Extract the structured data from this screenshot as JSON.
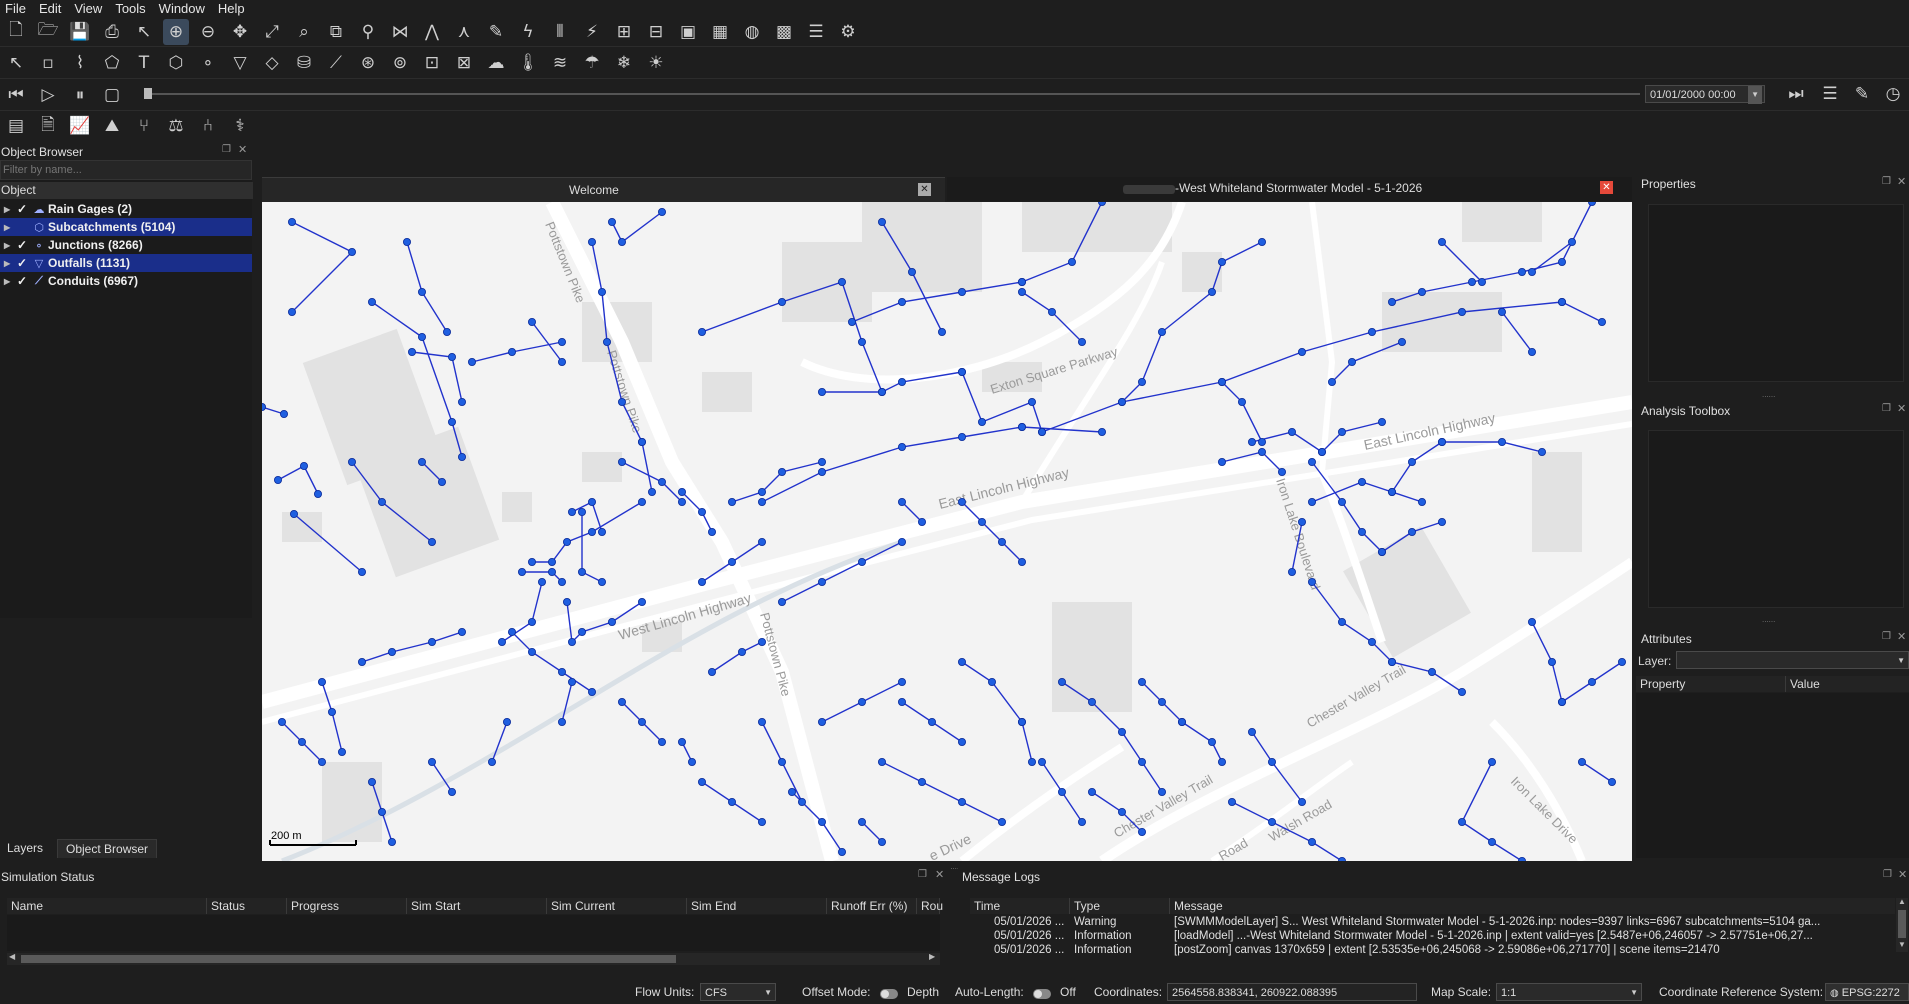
{
  "menu": [
    "File",
    "Edit",
    "View",
    "Tools",
    "Window",
    "Help"
  ],
  "toolbar1_icons": [
    "new-file-icon",
    "open-folder-icon",
    "save-icon",
    "print-icon",
    "select-icon",
    "zoom-in-icon",
    "zoom-out-icon",
    "pan-icon",
    "full-extent-icon",
    "zoom-rect-icon",
    "copy-icon",
    "find-icon",
    "network-icon",
    "vertex-icon",
    "profile-icon",
    "measure-icon",
    "flash-icon",
    "columns-icon",
    "lightning-icon",
    "map-add-icon",
    "map-edit-icon",
    "image-icon",
    "checker-icon",
    "globe-icon",
    "grid-icon",
    "sliders-icon",
    "settings-icon"
  ],
  "toolbar1_glyphs": [
    "🗋",
    "🗁",
    "💾",
    "⎙",
    "↖",
    "⊕",
    "⊖",
    "✥",
    "⤢",
    "⌕",
    "⧉",
    "⚲",
    "⋈",
    "⋀",
    "⋏",
    "✎",
    "ϟ",
    "⫴",
    "⚡",
    "⊞",
    "⊟",
    "▣",
    "▦",
    "◍",
    "▩",
    "☰",
    "⚙"
  ],
  "toolbar2_icons": [
    "select-arrow-icon",
    "node-icon",
    "polyline-icon",
    "polygon-icon",
    "text-icon",
    "polygon-draw-icon",
    "circle-icon",
    "outfall-icon",
    "diamond-icon",
    "storage-icon",
    "conduit-icon",
    "pump-icon",
    "orifice-icon",
    "weir-icon",
    "outlet-icon",
    "cloud-icon",
    "thermometer-icon",
    "wind-icon",
    "rain-cloud-icon",
    "snow-icon",
    "sun-icon"
  ],
  "toolbar2_glyphs": [
    "↖",
    "▫",
    "⌇",
    "⬠",
    "T",
    "⬡",
    "∘",
    "▽",
    "◇",
    "⛁",
    "⟋",
    "⊛",
    "⊚",
    "⊡",
    "⊠",
    "☁",
    "🌡",
    "≋",
    "☂",
    "❄",
    "☀"
  ],
  "toolbar3": {
    "datetime": "01/01/2000 00:00"
  },
  "toolbar4_icons": [
    "report-icon",
    "document-icon",
    "line-graph-icon",
    "profile-plot-icon",
    "branch-icon",
    "calibrate-icon",
    "tree-icon",
    "analysis-icon"
  ],
  "toolbar4_glyphs": [
    "▤",
    "🗎",
    "📈",
    "⛰",
    "⑂",
    "⚖",
    "⑃",
    "⚕"
  ],
  "object_browser": {
    "title": "Object Browser",
    "filter_placeholder": "Filter by name...",
    "column": "Object",
    "items": [
      {
        "label": "Rain Gages (2)",
        "icon": "☁",
        "selected": false,
        "checked": true
      },
      {
        "label": "Subcatchments (5104)",
        "icon": "⬡",
        "selected": true,
        "checked": false
      },
      {
        "label": "Junctions (8266)",
        "icon": "∘",
        "selected": false,
        "checked": true
      },
      {
        "label": "Outfalls (1131)",
        "icon": "▽",
        "selected": true,
        "checked": true
      },
      {
        "label": "Conduits (6967)",
        "icon": "⟋",
        "selected": false,
        "checked": true
      }
    ],
    "tabs": [
      "Layers",
      "Object Browser"
    ]
  },
  "doc_tabs": {
    "welcome": "Welcome",
    "model": "-West Whiteland Stormwater Model - 5-1-2026"
  },
  "map": {
    "scale_label": "200 m",
    "road_labels": {
      "potts_n": "Pottstown Pike",
      "potts_mid": "Pottstown Pike",
      "potts_s": "Pottstown Pike",
      "exton": "Exton Square Parkway",
      "lincoln_east": "East Lincoln Highway",
      "lincoln_mid": "East Lincoln Highway",
      "lincoln_west": "West Lincoln Highway",
      "chester1": "Chester Valley Trail",
      "chester2": "Chester Valley Trail",
      "ironlake": "Iron Lake Boulevard",
      "ironlake2": "Iron Lake Drive",
      "walsh": "Walsh Road",
      "roade": "Road",
      "drive": "e Drive"
    }
  },
  "properties": {
    "title": "Properties"
  },
  "analysis_toolbox": {
    "title": "Analysis Toolbox"
  },
  "attributes": {
    "title": "Attributes",
    "layer_label": "Layer:",
    "col_property": "Property",
    "col_value": "Value"
  },
  "simulation_status": {
    "title": "Simulation Status",
    "columns": [
      "Name",
      "Status",
      "Progress",
      "Sim Start",
      "Sim Current",
      "Sim End",
      "Runoff Err (%)",
      "Rou"
    ]
  },
  "message_logs": {
    "title": "Message Logs",
    "columns": [
      "Time",
      "Type",
      "Message"
    ],
    "rows": [
      {
        "time": "05/01/2026 ...",
        "type": "Warning",
        "message": "[SWMMModelLayer] S... West Whiteland Stormwater Model - 5-1-2026.inp: nodes=9397 links=6967 subcatchments=5104 ga..."
      },
      {
        "time": "05/01/2026 ...",
        "type": "Information",
        "message": "[loadModel] ...-West Whiteland Stormwater Model - 5-1-2026.inp | extent valid=yes [2.5487e+06,246057 -> 2.57751e+06,27..."
      },
      {
        "time": "05/01/2026 ...",
        "type": "Information",
        "message": "[postZoom] canvas 1370x659 | extent [2.53535e+06,245068 -> 2.59086e+06,271770] | scene items=21470"
      }
    ]
  },
  "statusbar": {
    "flow_units_label": "Flow Units:",
    "flow_units_value": "CFS",
    "offset_label": "Offset Mode:",
    "offset_value": "Depth",
    "autolength_label": "Auto-Length:",
    "autolength_value": "Off",
    "coords_label": "Coordinates:",
    "coords_value": "2564558.838341, 260922.088395",
    "scale_label": "Map Scale:",
    "scale_value": "1:1",
    "crs_label": "Coordinate Reference System:",
    "crs_value": "EPSG:2272"
  },
  "colors": {
    "accent": "#1a2e8a",
    "network": "#2233cc",
    "node": "#1f5fe0",
    "map_bg": "#f3f3f3"
  }
}
